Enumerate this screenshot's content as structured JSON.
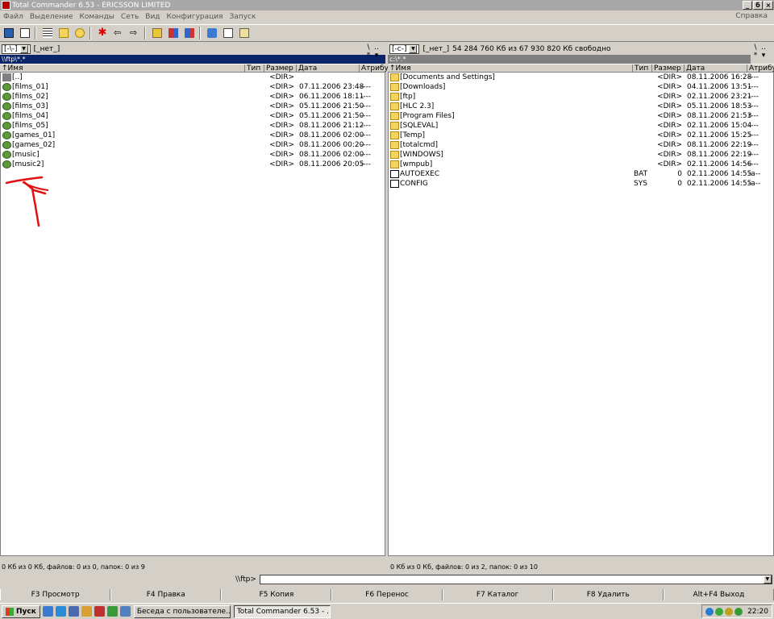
{
  "window": {
    "title": "Total Commander 6.53 - ERICSSON LIMITED",
    "min": "_",
    "restore": "б",
    "close": "×"
  },
  "menu": {
    "items": [
      "Файл",
      "Выделение",
      "Команды",
      "Сеть",
      "Вид",
      "Конфигурация",
      "Запуск"
    ],
    "help": "Справка"
  },
  "toolbar": {
    "icons": [
      "refresh-icon",
      "view-icon",
      "brief-icon",
      "tree-icon",
      "sort-icon",
      "star-icon",
      "back-icon",
      "forward-icon",
      "archive-icon",
      "pack-icon",
      "unpack-icon",
      "ftp-icon",
      "notepad-icon"
    ]
  },
  "columns": {
    "name": "↑Имя",
    "type": "Тип",
    "size": "Размер",
    "date": "Дата",
    "attr": "Атрибу"
  },
  "left": {
    "drive": "[-\\-]",
    "label": "[_нет_]",
    "free": "",
    "path": "\\\\ftp\\*.*",
    "files": [
      {
        "name": "[..]",
        "type": "",
        "size": "<DIR>",
        "date": "",
        "attr": "",
        "icon": "up"
      },
      {
        "name": "[films_01]",
        "type": "",
        "size": "<DIR>",
        "date": "07.11.2006 23:48",
        "attr": "----",
        "icon": "ftp"
      },
      {
        "name": "[films_02]",
        "type": "",
        "size": "<DIR>",
        "date": "06.11.2006 18:11",
        "attr": "----",
        "icon": "ftp"
      },
      {
        "name": "[films_03]",
        "type": "",
        "size": "<DIR>",
        "date": "05.11.2006 21:50",
        "attr": "----",
        "icon": "ftp"
      },
      {
        "name": "[films_04]",
        "type": "",
        "size": "<DIR>",
        "date": "05.11.2006 21:50",
        "attr": "----",
        "icon": "ftp"
      },
      {
        "name": "[films_05]",
        "type": "",
        "size": "<DIR>",
        "date": "08.11.2006 21:12",
        "attr": "----",
        "icon": "ftp"
      },
      {
        "name": "[games_01]",
        "type": "",
        "size": "<DIR>",
        "date": "08.11.2006 02:00",
        "attr": "----",
        "icon": "ftp"
      },
      {
        "name": "[games_02]",
        "type": "",
        "size": "<DIR>",
        "date": "08.11.2006 00:20",
        "attr": "----",
        "icon": "ftp"
      },
      {
        "name": "[music]",
        "type": "",
        "size": "<DIR>",
        "date": "08.11.2006 02:00",
        "attr": "----",
        "icon": "ftp"
      },
      {
        "name": "[music2]",
        "type": "",
        "size": "<DIR>",
        "date": "08.11.2006 20:05",
        "attr": "----",
        "icon": "ftp"
      }
    ],
    "status": "0 Кб из 0 Кб, файлов: 0 из 0, папок: 0 из 9"
  },
  "right": {
    "drive": "[-c-]",
    "label": "[_нет_]",
    "free": "54 284 760 Кб из 67 930 820 Кб свободно",
    "path": "c:\\*.*",
    "files": [
      {
        "name": "[Documents and Settings]",
        "type": "",
        "size": "<DIR>",
        "date": "08.11.2006 16:28",
        "attr": "----",
        "icon": "folder"
      },
      {
        "name": "[Downloads]",
        "type": "",
        "size": "<DIR>",
        "date": "04.11.2006 13:51",
        "attr": "----",
        "icon": "folder"
      },
      {
        "name": "[ftp]",
        "type": "",
        "size": "<DIR>",
        "date": "02.11.2006 23:21",
        "attr": "----",
        "icon": "folder"
      },
      {
        "name": "[HLC 2.3]",
        "type": "",
        "size": "<DIR>",
        "date": "05.11.2006 18:53",
        "attr": "----",
        "icon": "folder"
      },
      {
        "name": "[Program Files]",
        "type": "",
        "size": "<DIR>",
        "date": "08.11.2006 21:53",
        "attr": "r---",
        "icon": "folder"
      },
      {
        "name": "[SQLEVAL]",
        "type": "",
        "size": "<DIR>",
        "date": "02.11.2006 15:04",
        "attr": "----",
        "icon": "folder"
      },
      {
        "name": "[Temp]",
        "type": "",
        "size": "<DIR>",
        "date": "02.11.2006 15:25",
        "attr": "----",
        "icon": "folder"
      },
      {
        "name": "[totalcmd]",
        "type": "",
        "size": "<DIR>",
        "date": "08.11.2006 22:19",
        "attr": "----",
        "icon": "folder"
      },
      {
        "name": "[WINDOWS]",
        "type": "",
        "size": "<DIR>",
        "date": "08.11.2006 22:19",
        "attr": "----",
        "icon": "folder"
      },
      {
        "name": "[wmpub]",
        "type": "",
        "size": "<DIR>",
        "date": "02.11.2006 14:56",
        "attr": "----",
        "icon": "folder"
      },
      {
        "name": "AUTOEXEC",
        "type": "BAT",
        "size": "0",
        "date": "02.11.2006 14:55",
        "attr": "-a--",
        "icon": "file"
      },
      {
        "name": "CONFIG",
        "type": "SYS",
        "size": "0",
        "date": "02.11.2006 14:55",
        "attr": "-a--",
        "icon": "file"
      }
    ],
    "status": "0 Кб из 0 Кб, файлов: 0 из 2, папок: 0 из 10"
  },
  "side_buttons": {
    "root": "\\",
    "up": "..",
    "star": "*",
    "dropdown": "▾"
  },
  "cmdline": {
    "label": "\\\\ftp>",
    "value": ""
  },
  "fkeys": [
    "F3 Просмотр",
    "F4 Правка",
    "F5 Копия",
    "F6 Перенос",
    "F7 Каталог",
    "F8 Удалить",
    "Alt+F4 Выход"
  ],
  "taskbar": {
    "start": "Пуск",
    "tasks": [
      "Беседа с пользователе...",
      "Total Commander 6.53 - ..."
    ],
    "clock": "22:20"
  },
  "colors": {
    "active_path": "#0a246a",
    "inactive_path": "#808080",
    "annotation": "#e01010"
  }
}
